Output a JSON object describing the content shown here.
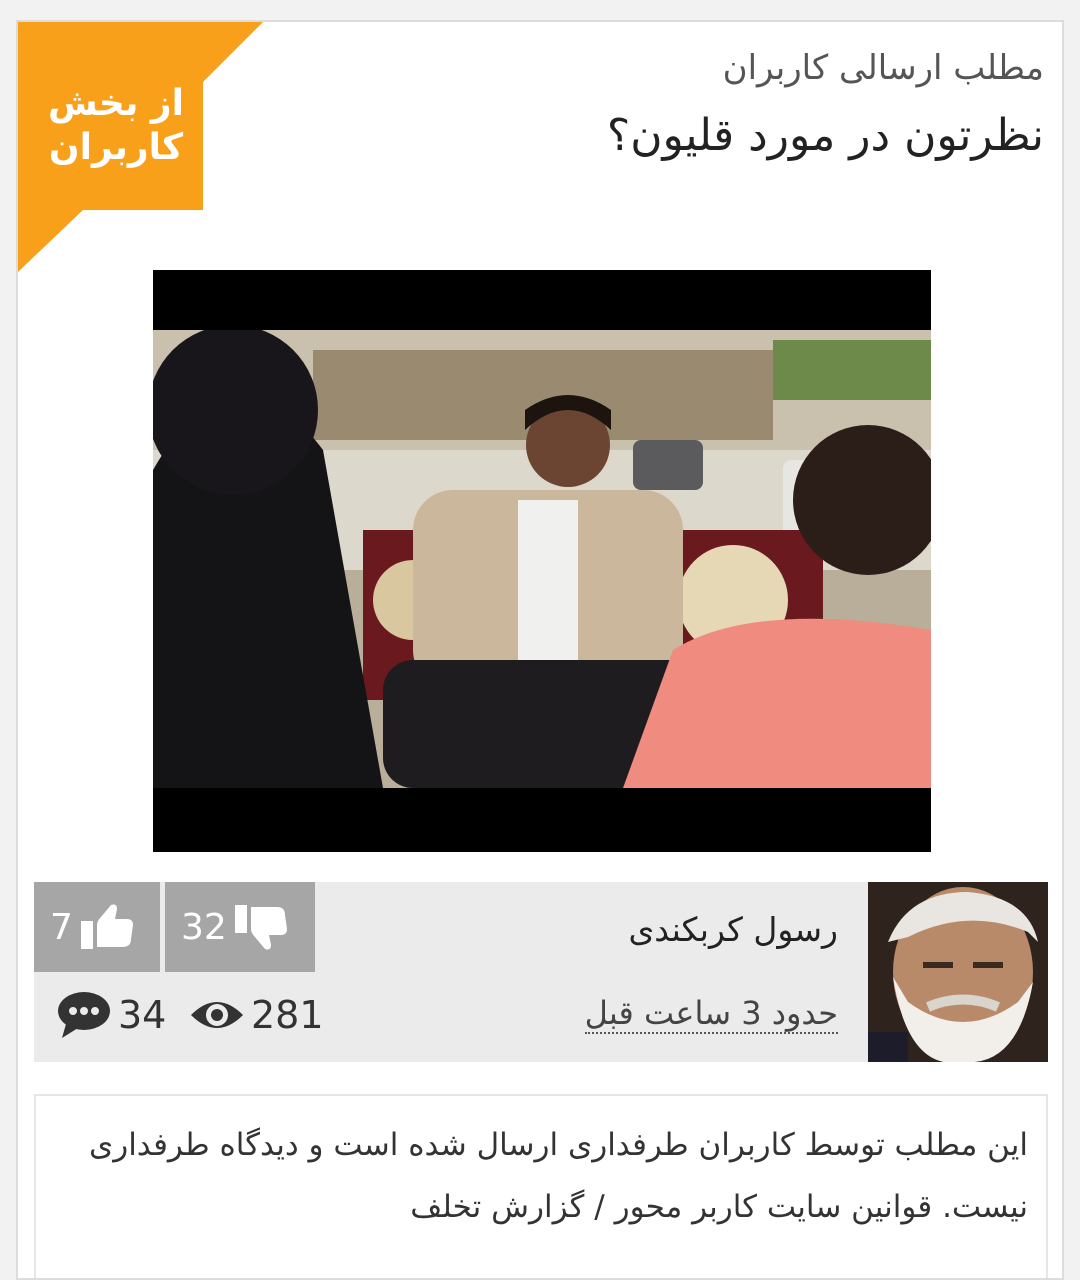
{
  "ribbon": {
    "line1": "از بخش",
    "line2": "کاربران",
    "color": "#f9a01b"
  },
  "post": {
    "kicker": "مطلب ارسالی کاربران",
    "title": "نظرتون در مورد قلیون؟"
  },
  "meta": {
    "author": "رسول کربکندی",
    "time": "حدود 3 ساعت قبل",
    "dislikes": "32",
    "likes": "7",
    "views": "281",
    "comments": "34"
  },
  "disclaimer": {
    "text": "این مطلب توسط کاربران طرفداری ارسال شده است و دیدگاه طرفداری نیست.",
    "rules_link": "قوانین سایت کاربر محور",
    "separator": "/",
    "report_link": "گزارش تخلف"
  }
}
